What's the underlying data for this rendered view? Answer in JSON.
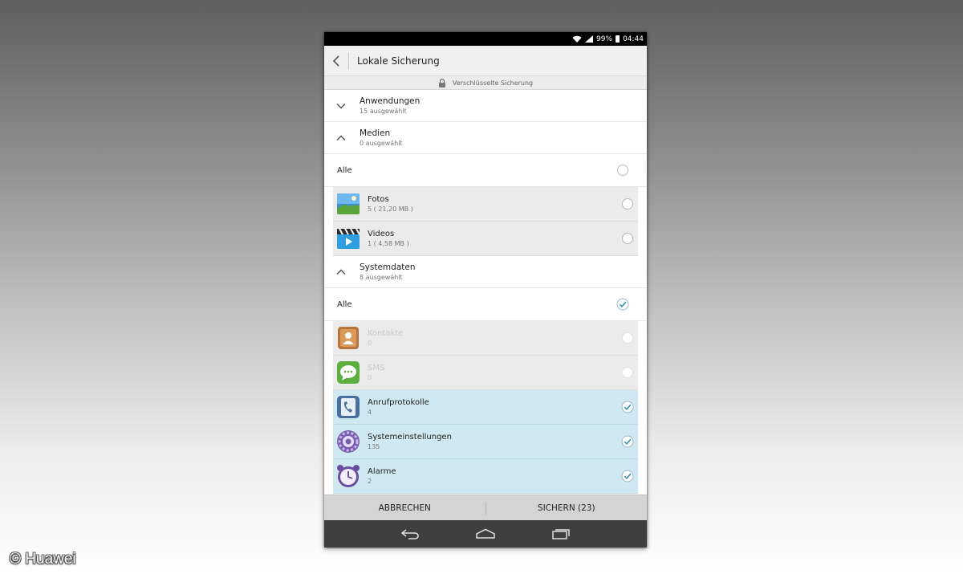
{
  "status_bar": {
    "battery": "99%",
    "time": "04:44"
  },
  "action_bar": {
    "title": "Lokale Sicherung"
  },
  "encryption_bar": {
    "label": "Verschlüsselte Sicherung"
  },
  "groups": {
    "anwendungen": {
      "title": "Anwendungen",
      "subtitle": "15 ausgewählt"
    },
    "medien": {
      "title": "Medien",
      "subtitle": "0 ausgewählt",
      "all_label": "Alle",
      "items": [
        {
          "title": "Fotos",
          "subtitle": "5 ( 21,20 MB )"
        },
        {
          "title": "Videos",
          "subtitle": "1 ( 4,58 MB )"
        }
      ]
    },
    "systemdaten": {
      "title": "Systemdaten",
      "subtitle": "8 ausgewählt",
      "all_label": "Alle",
      "items": [
        {
          "title": "Kontakte",
          "subtitle": "0"
        },
        {
          "title": "SMS",
          "subtitle": "0"
        },
        {
          "title": "Anrufprotokolle",
          "subtitle": "4"
        },
        {
          "title": "Systemeinstellungen",
          "subtitle": "135"
        },
        {
          "title": "Alarme",
          "subtitle": "2"
        }
      ]
    }
  },
  "buttons": {
    "cancel": "ABBRECHEN",
    "save": "SICHERN (23)"
  },
  "watermark": "© Huawei",
  "colors": {
    "selected_row": "#cfe8f1",
    "check": "#3a8fb5",
    "statusbar": "#000000",
    "navbar": "#3f3f3f"
  }
}
